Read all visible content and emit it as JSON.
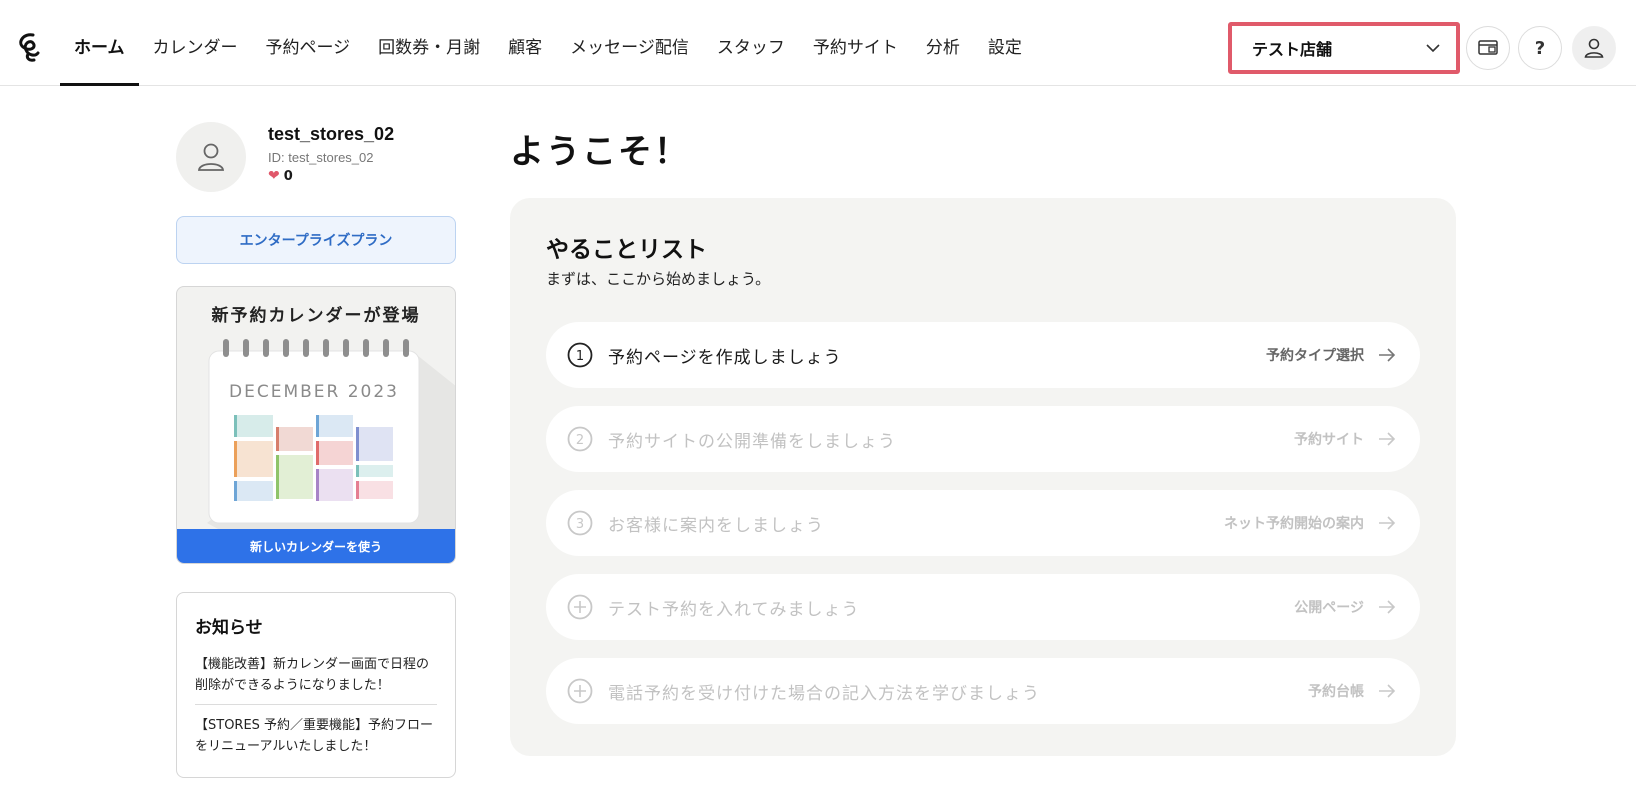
{
  "header": {
    "nav": [
      {
        "label": "ホーム",
        "active": true
      },
      {
        "label": "カレンダー"
      },
      {
        "label": "予約ページ"
      },
      {
        "label": "回数券・月謝"
      },
      {
        "label": "顧客"
      },
      {
        "label": "メッセージ配信"
      },
      {
        "label": "スタッフ"
      },
      {
        "label": "予約サイト"
      },
      {
        "label": "分析"
      },
      {
        "label": "設定"
      }
    ],
    "store_select": {
      "value": "テスト店舗",
      "highlight_color": "#e05a6a"
    },
    "help_label": "?"
  },
  "profile": {
    "username": "test_stores_02",
    "user_id": "ID: test_stores_02",
    "likes": "0"
  },
  "plan": {
    "label": "エンタープライズプラン"
  },
  "promo": {
    "title": "新予約カレンダーが登場",
    "calendar_month": "DECEMBER 2023",
    "button_label": "新しいカレンダーを使う"
  },
  "news": {
    "title": "お知らせ",
    "items": [
      "【機能改善】新カレンダー画面で日程の削除ができるようになりました！",
      "【STORES 予約／重要機能】予約フローをリニューアルいたしました！"
    ]
  },
  "main": {
    "welcome": "ようこそ！",
    "todo": {
      "title": "やることリスト",
      "subtitle": "まずは、ここから始めましょう。",
      "tasks": [
        {
          "icon": "number-1-icon",
          "label": "予約ページを作成しましょう",
          "link": "予約タイプ選択",
          "state": "enabled"
        },
        {
          "icon": "number-2-icon",
          "label": "予約サイトの公開準備をしましょう",
          "link": "予約サイト",
          "state": "disabled"
        },
        {
          "icon": "number-3-icon",
          "label": "お客様に案内をしましょう",
          "link": "ネット予約開始の案内",
          "state": "disabled"
        },
        {
          "icon": "plus-circle-icon",
          "label": "テスト予約を入れてみましょう",
          "link": "公開ページ",
          "state": "disabled"
        },
        {
          "icon": "plus-circle-icon",
          "label": "電話予約を受け付けた場合の記入方法を学びましょう",
          "link": "予約台帳",
          "state": "disabled"
        }
      ]
    }
  },
  "colors": {
    "accent_blue": "#2e72e8",
    "plan_text": "#2f6cc5",
    "heart": "#e0576a",
    "card_bg": "#f4f4f2"
  }
}
